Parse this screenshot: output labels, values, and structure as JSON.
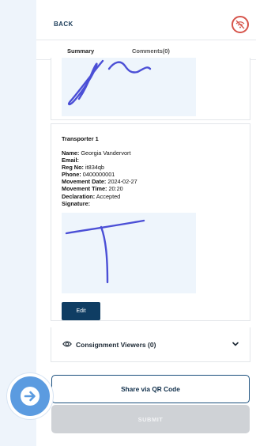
{
  "header": {
    "back_label": "BACK",
    "status_icon": "no-signal-icon"
  },
  "tabs": [
    {
      "label": "Summary",
      "active": true
    },
    {
      "label": "Comments(0)",
      "active": false
    }
  ],
  "transporter": {
    "title": "Transporter 1",
    "fields": [
      {
        "key": "Name:",
        "value": "Georgia Vandervort"
      },
      {
        "key": "Email:",
        "value": ""
      },
      {
        "key": "Reg No:",
        "value": "it834qb"
      },
      {
        "key": "Phone:",
        "value": "0400000001"
      },
      {
        "key": "Movement Date:",
        "value": "2024-02-27"
      },
      {
        "key": "Movement Time:",
        "value": "20:20"
      },
      {
        "key": "Declaration:",
        "value": "Accepted"
      },
      {
        "key": "Signature:",
        "value": ""
      }
    ],
    "edit_label": "Edit"
  },
  "viewers": {
    "label": "Consignment Viewers (0)",
    "icon": "eye-icon",
    "chevron": "chevron-down-icon"
  },
  "actions": {
    "share_label": "Share via QR Code",
    "submit_label": "SUBMIT"
  },
  "overlay": {
    "icon": "arrow-right-icon"
  },
  "colors": {
    "accent": "#0f3d63",
    "signature_ink": "#4b4fd6",
    "signature_bg": "#eef5fc",
    "fab": "#5b9be0"
  }
}
